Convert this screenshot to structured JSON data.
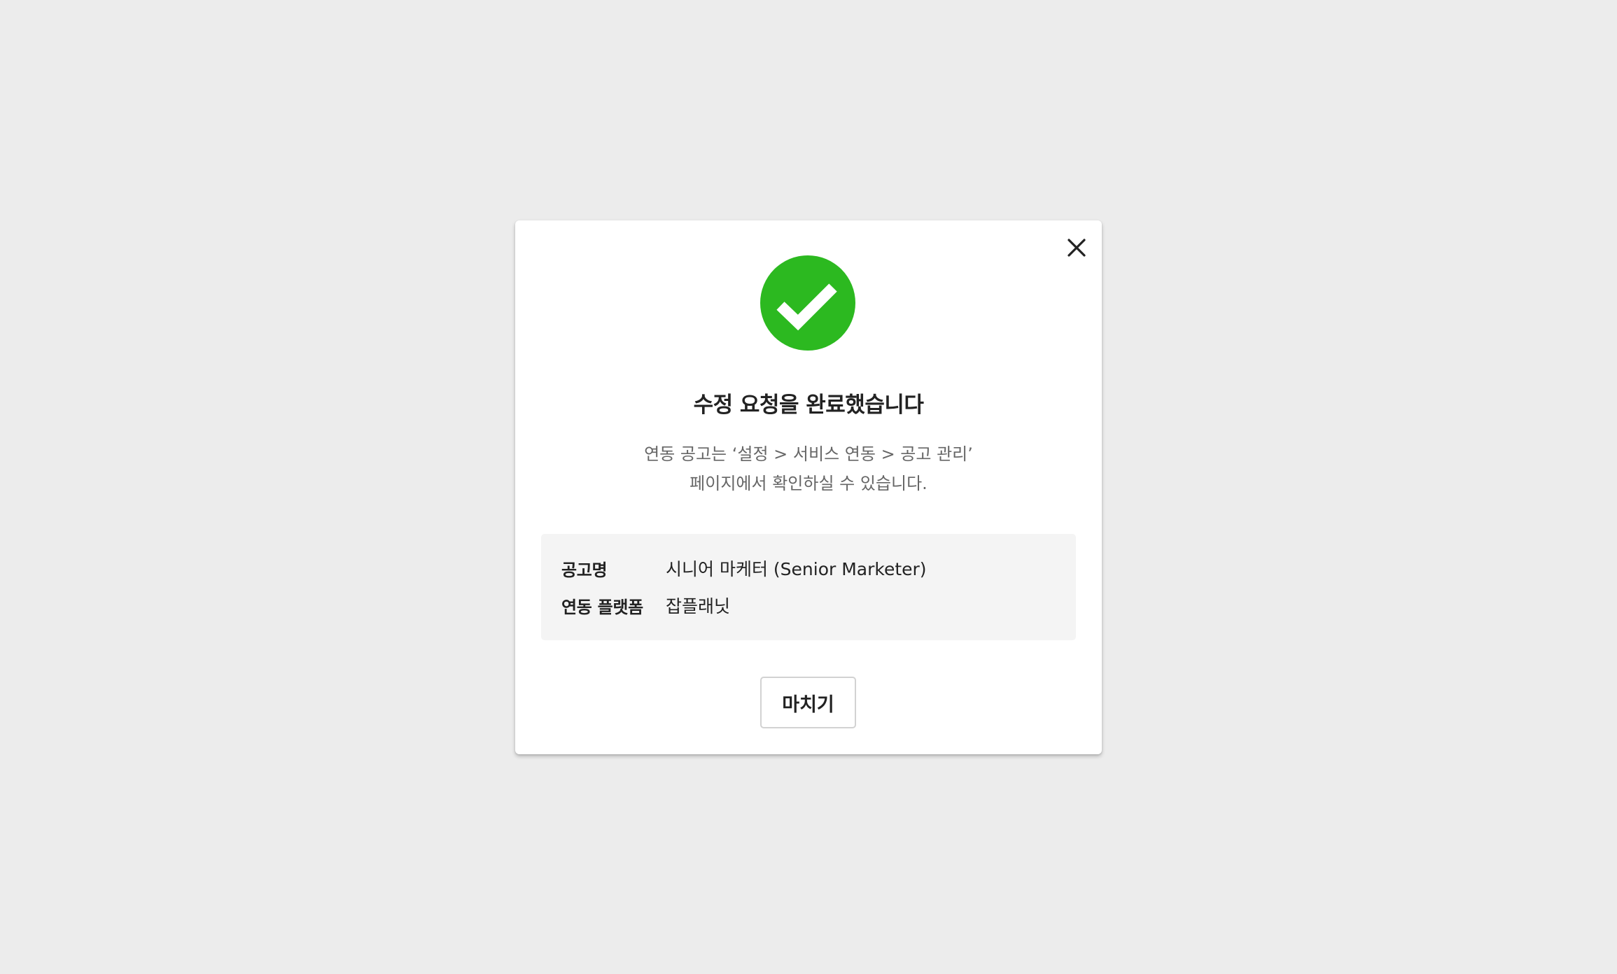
{
  "modal": {
    "title": "수정 요청을 완료했습니다",
    "description_line1": "연동 공고는 ‘설정 > 서비스 연동 > 공고 관리’",
    "description_line2": "페이지에서 확인하실 수 있습니다.",
    "close_icon": "close-icon",
    "status_icon": "check-circle-icon",
    "status_color": "#2cb920",
    "info": [
      {
        "label": "공고명",
        "value": "시니어 마케터 (Senior Marketer)"
      },
      {
        "label": "연동 플랫폼",
        "value": "잡플래닛"
      }
    ],
    "finish_label": "마치기"
  }
}
